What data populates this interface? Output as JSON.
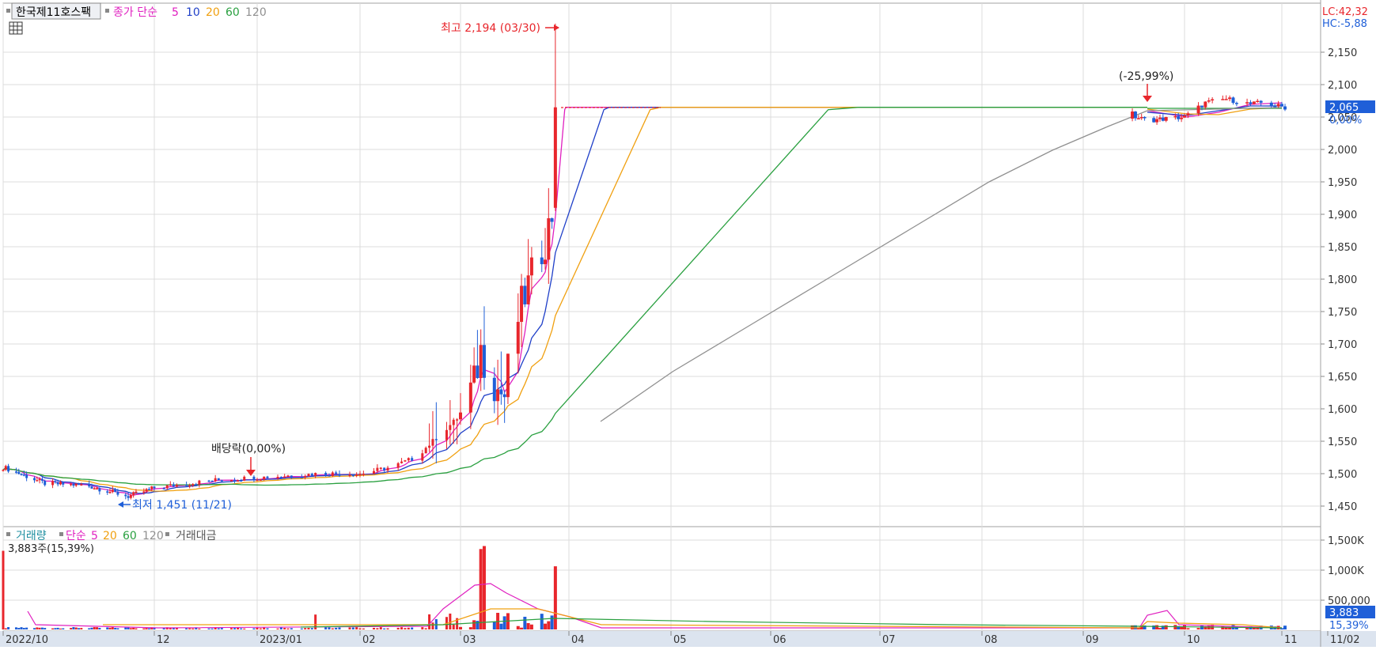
{
  "header": {
    "stock_name": "한국제11호스팩",
    "ma_label": "종가 단순",
    "ma_periods": [
      "5",
      "10",
      "20",
      "60",
      "120"
    ]
  },
  "volume_header": {
    "label": "거래량",
    "ma_label": "단순",
    "ma_periods": [
      "5",
      "20",
      "60",
      "120"
    ],
    "amount_label": "거래대금",
    "value_text": "3,883주(15,39%)"
  },
  "right_panel": {
    "lc": "LC:42,32",
    "hc": "HC:-5,88",
    "price_badge": "2,065",
    "pct_text": "0,00%",
    "volume_badge": "3,883",
    "volume_pct": "15,39%"
  },
  "annotations": {
    "high": "최고 2,194 (03/30)",
    "low": "최저 1,451 (11/21)",
    "dividend": "배당락(0,00%)",
    "pct_change": "(-25,99%)"
  },
  "colors": {
    "up": "#e8262c",
    "down": "#1f5fd8",
    "ma5": "#e020c0",
    "ma10": "#1f3fc8",
    "ma20": "#f0a010",
    "ma60": "#2aa040",
    "ma120": "#909090",
    "grid": "#dcdcdc",
    "axis_bg": "#dce4ef"
  },
  "chart_data": [
    {
      "type": "candlestick",
      "title": "",
      "y_ticks": [
        "2,150",
        "2,100",
        "2,050",
        "2,000",
        "1,950",
        "1,900",
        "1,850",
        "1,800",
        "1,750",
        "1,700",
        "1,650",
        "1,600",
        "1,550",
        "1,500",
        "1,450"
      ],
      "ylim": [
        1420,
        2215
      ],
      "x_ticks": [
        "2022/10",
        "12",
        "2023/01",
        "02",
        "03",
        "04",
        "05",
        "06",
        "07",
        "08",
        "09",
        "10",
        "11",
        "11/02"
      ],
      "grid": true,
      "series_ma": [
        "5",
        "10",
        "20",
        "60",
        "120"
      ],
      "high_point": {
        "date": "03/30",
        "value": 2194
      },
      "low_point": {
        "date": "11/21",
        "value": 1451
      },
      "last_close": 2065
    },
    {
      "type": "bar",
      "title": "",
      "y_ticks": [
        "1,500K",
        "1,000K",
        "500,000"
      ],
      "ylim": [
        0,
        1600000
      ],
      "last_value": 3883
    }
  ]
}
